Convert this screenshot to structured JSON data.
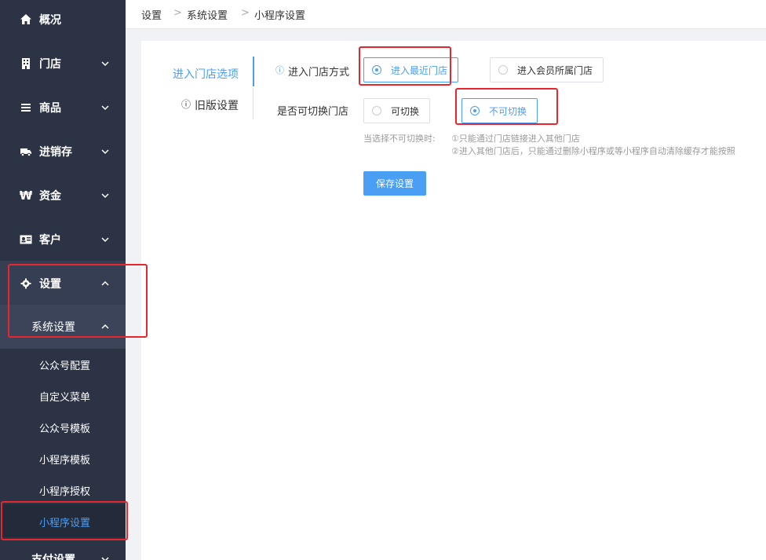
{
  "sidebar": {
    "items": [
      {
        "label": "概况",
        "icon": "home-icon"
      },
      {
        "label": "门店",
        "icon": "building-icon"
      },
      {
        "label": "商品",
        "icon": "list-icon"
      },
      {
        "label": "进销存",
        "icon": "truck-icon"
      },
      {
        "label": "资金",
        "icon": "won-icon"
      },
      {
        "label": "客户",
        "icon": "id-card-icon"
      },
      {
        "label": "设置",
        "icon": "gear-icon"
      }
    ],
    "group": {
      "label": "系统设置"
    },
    "subitems": [
      {
        "label": "公众号配置"
      },
      {
        "label": "自定义菜单"
      },
      {
        "label": "公众号模板"
      },
      {
        "label": "小程序模板"
      },
      {
        "label": "小程序授权"
      },
      {
        "label": "小程序设置"
      }
    ],
    "next_item": {
      "label": "支付设置"
    }
  },
  "breadcrumb": {
    "items": [
      "设置",
      "系统设置",
      "小程序设置"
    ],
    "separator": ">"
  },
  "tabs": {
    "active": "进入门店选项",
    "other": "旧版设置",
    "other_icon": "ⓘ"
  },
  "form": {
    "entry_mode": {
      "icon": "ⓘ",
      "label": "进入门店方式",
      "options": [
        "进入最近门店",
        "进入会员所属门店"
      ],
      "selected": "进入最近门店"
    },
    "switchable": {
      "label": "是否可切换门店",
      "options": [
        "可切换",
        "不可切换"
      ],
      "selected": "不可切换"
    },
    "hint": {
      "prefix": "当选择不可切换时:",
      "line1": "①只能通过门店链接进入其他门店",
      "line2": "②进入其他门店后，只能通过删除小程序或等小程序自动清除缓存才能按照"
    },
    "save_label": "保存设置"
  },
  "colors": {
    "sidebar_bg": "#2b3345",
    "accent": "#4a9ff5",
    "annotation": "#e8262d"
  }
}
